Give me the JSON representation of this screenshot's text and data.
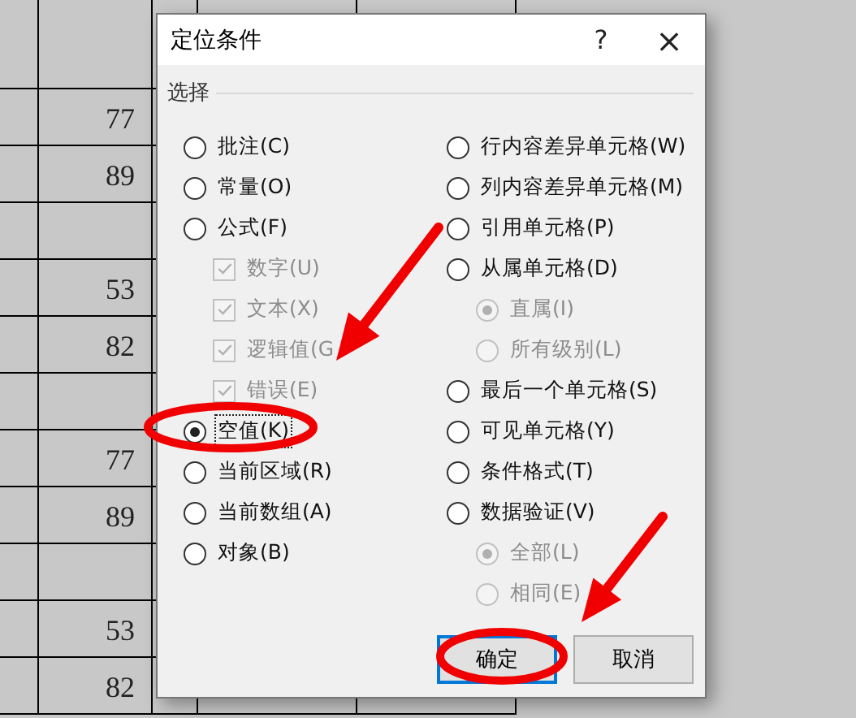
{
  "spreadsheet": {
    "rows": [
      {
        "kind": "empty"
      },
      {
        "kind": "number",
        "value": "77"
      },
      {
        "kind": "number",
        "value": "89"
      },
      {
        "kind": "empty"
      },
      {
        "kind": "number",
        "value": "53"
      },
      {
        "kind": "number",
        "value": "82"
      },
      {
        "kind": "empty"
      },
      {
        "kind": "number",
        "value": "77"
      },
      {
        "kind": "number",
        "value": "89"
      },
      {
        "kind": "empty"
      },
      {
        "kind": "number",
        "value": "53"
      },
      {
        "kind": "number",
        "value": "82"
      }
    ]
  },
  "dialog": {
    "title": "定位条件",
    "help": "?",
    "close": "×",
    "group": "选择",
    "columns": [
      [
        {
          "kind": "radio",
          "label": "批注(C)",
          "selected": false,
          "disabled": false
        },
        {
          "kind": "radio",
          "label": "常量(O)",
          "selected": false,
          "disabled": false
        },
        {
          "kind": "radio",
          "label": "公式(F)",
          "selected": false,
          "disabled": false,
          "children": [
            {
              "kind": "check",
              "label": "数字(U)",
              "checked": true,
              "disabled": true
            },
            {
              "kind": "check",
              "label": "文本(X)",
              "checked": true,
              "disabled": true
            },
            {
              "kind": "check",
              "label": "逻辑值(G",
              "checked": true,
              "disabled": true
            },
            {
              "kind": "check",
              "label": "错误(E)",
              "checked": true,
              "disabled": true
            }
          ]
        },
        {
          "kind": "radio",
          "label": "空值(K)",
          "selected": true,
          "disabled": false,
          "focused": true
        },
        {
          "kind": "radio",
          "label": "当前区域(R)",
          "selected": false,
          "disabled": false
        },
        {
          "kind": "radio",
          "label": "当前数组(A)",
          "selected": false,
          "disabled": false
        },
        {
          "kind": "radio",
          "label": "对象(B)",
          "selected": false,
          "disabled": false
        }
      ],
      [
        {
          "kind": "radio",
          "label": "行内容差异单元格(W)",
          "selected": false,
          "disabled": false
        },
        {
          "kind": "radio",
          "label": "列内容差异单元格(M)",
          "selected": false,
          "disabled": false
        },
        {
          "kind": "radio",
          "label": "引用单元格(P)",
          "selected": false,
          "disabled": false
        },
        {
          "kind": "radio",
          "label": "从属单元格(D)",
          "selected": false,
          "disabled": false,
          "children": [
            {
              "kind": "radio",
              "label": "直属(I)",
              "selected": true,
              "disabled": true
            },
            {
              "kind": "radio",
              "label": "所有级别(L)",
              "selected": false,
              "disabled": true
            }
          ]
        },
        {
          "kind": "radio",
          "label": "最后一个单元格(S)",
          "selected": false,
          "disabled": false
        },
        {
          "kind": "radio",
          "label": "可见单元格(Y)",
          "selected": false,
          "disabled": false
        },
        {
          "kind": "radio",
          "label": "条件格式(T)",
          "selected": false,
          "disabled": false
        },
        {
          "kind": "radio",
          "label": "数据验证(V)",
          "selected": false,
          "disabled": false,
          "children": [
            {
              "kind": "radio",
              "label": "全部(L)",
              "selected": true,
              "disabled": true
            },
            {
              "kind": "radio",
              "label": "相同(E)",
              "selected": false,
              "disabled": true
            }
          ]
        }
      ]
    ],
    "buttons": [
      {
        "label": "确定",
        "focused": true
      },
      {
        "label": "取消",
        "focused": false
      }
    ]
  }
}
